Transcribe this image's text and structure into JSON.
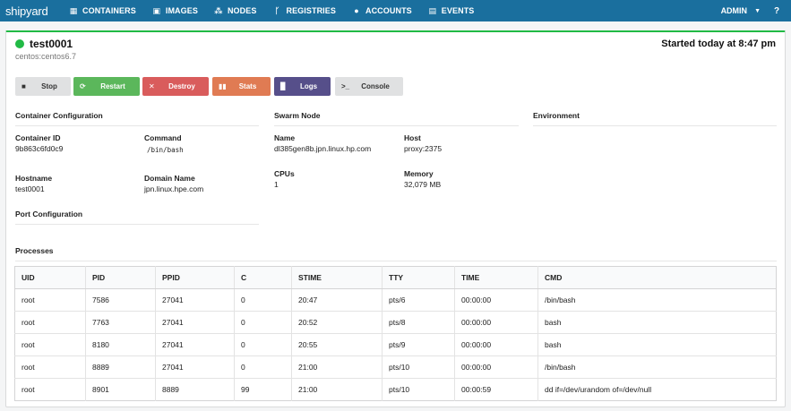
{
  "nav": {
    "brand": "shipyard",
    "items": [
      {
        "label": "CONTAINERS",
        "icon": "▦"
      },
      {
        "label": "IMAGES",
        "icon": "▣"
      },
      {
        "label": "NODES",
        "icon": "⁂"
      },
      {
        "label": "REGISTRIES",
        "icon": "ᚴ"
      },
      {
        "label": "ACCOUNTS",
        "icon": "●"
      },
      {
        "label": "EVENTS",
        "icon": "▤"
      }
    ],
    "user": "ADMIN",
    "help": "?"
  },
  "container": {
    "name": "test0001",
    "image": "centos:centos6.7",
    "started": "Started today at 8:47 pm",
    "status_color": "#21ba45"
  },
  "actions": {
    "stop": "Stop",
    "restart": "Restart",
    "destroy": "Destroy",
    "stats": "Stats",
    "logs": "Logs",
    "console": "Console"
  },
  "config": {
    "title": "Container Configuration",
    "id_label": "Container ID",
    "id_value": "9b863c6fd0c9",
    "command_label": "Command",
    "command_value": "/bin/bash",
    "hostname_label": "Hostname",
    "hostname_value": "test0001",
    "domain_label": "Domain Name",
    "domain_value": "jpn.linux.hpe.com"
  },
  "swarm": {
    "title": "Swarm Node",
    "name_label": "Name",
    "name_value": "dl385gen8b.jpn.linux.hp.com",
    "host_label": "Host",
    "host_value": "proxy:2375",
    "cpus_label": "CPUs",
    "cpus_value": "1",
    "memory_label": "Memory",
    "memory_value": "32,079 MB"
  },
  "environment": {
    "title": "Environment"
  },
  "ports": {
    "title": "Port Configuration"
  },
  "processes": {
    "title": "Processes",
    "headers": [
      "UID",
      "PID",
      "PPID",
      "C",
      "STIME",
      "TTY",
      "TIME",
      "CMD"
    ],
    "rows": [
      [
        "root",
        "7586",
        "27041",
        "0",
        "20:47",
        "pts/6",
        "00:00:00",
        "/bin/bash"
      ],
      [
        "root",
        "7763",
        "27041",
        "0",
        "20:52",
        "pts/8",
        "00:00:00",
        "bash"
      ],
      [
        "root",
        "8180",
        "27041",
        "0",
        "20:55",
        "pts/9",
        "00:00:00",
        "bash"
      ],
      [
        "root",
        "8889",
        "27041",
        "0",
        "21:00",
        "pts/10",
        "00:00:00",
        "/bin/bash"
      ],
      [
        "root",
        "8901",
        "8889",
        "99",
        "21:00",
        "pts/10",
        "00:00:59",
        "dd if=/dev/urandom of=/dev/null"
      ]
    ]
  }
}
